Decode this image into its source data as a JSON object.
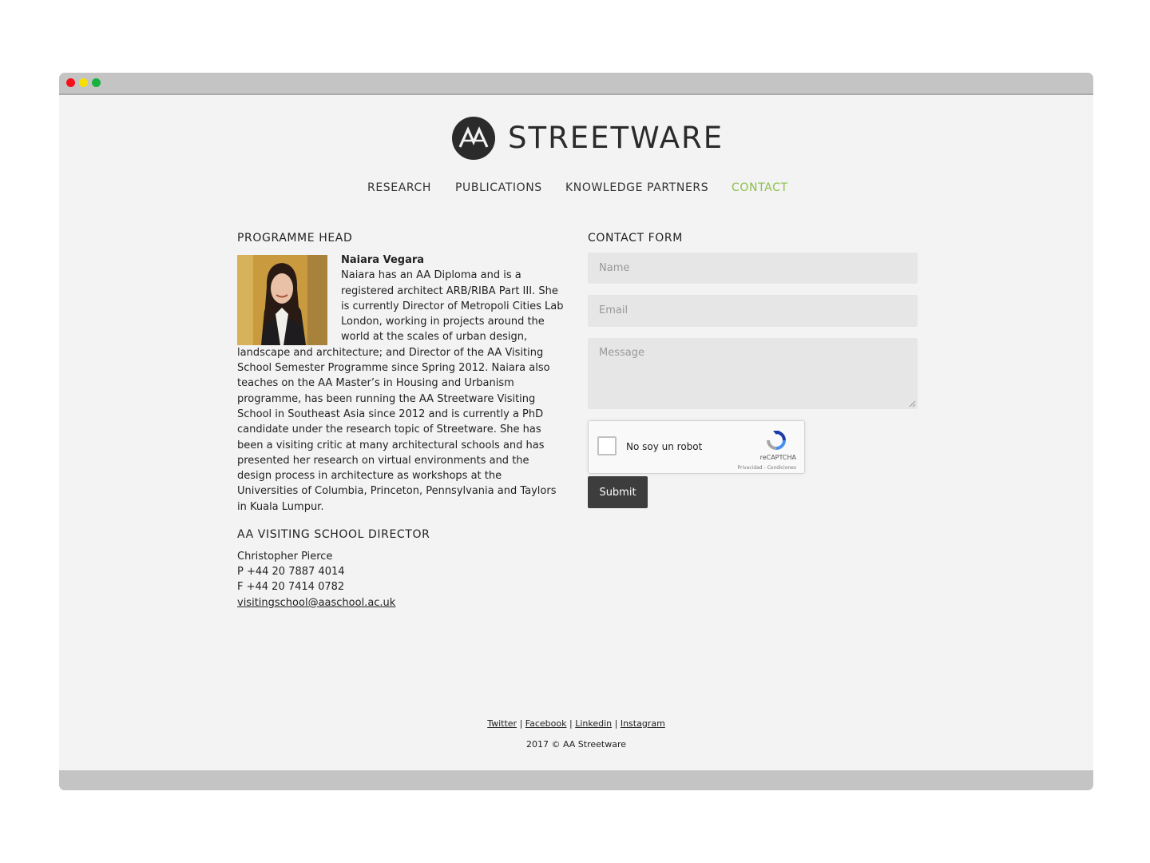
{
  "window": {
    "controls": [
      "close",
      "minimize",
      "zoom"
    ]
  },
  "brand": {
    "name": "STREETWARE",
    "logo_icon": "aa-logo-icon"
  },
  "nav": {
    "items": [
      {
        "label": "RESEARCH",
        "active": false
      },
      {
        "label": "PUBLICATIONS",
        "active": false
      },
      {
        "label": "KNOWLEDGE PARTNERS",
        "active": false
      },
      {
        "label": "CONTACT",
        "active": true
      }
    ],
    "active_color": "#8cc04a"
  },
  "programme_head": {
    "heading": "PROGRAMME HEAD",
    "name": "Naiara Vegara",
    "bio": "Naiara has an AA Diploma and is a registered architect ARB/RIBA Part III. She is currently Director of Metropoli Cities Lab London, working in projects around the world at the scales of urban design, landscape and architecture; and Director of the AA Visiting School Semester Programme since Spring 2012. Naiara also teaches on the AA Master’s in Housing and Urbanism programme, has been running the AA Streetware Visiting School in Southeast Asia since 2012 and is currently a PhD candidate under the research topic of Streetware. She has been a visiting critic at many architectural schools and has presented her research on virtual environments and the design process in architecture as workshops at the Universities of Columbia, Princeton, Pennsylvania and Taylors in Kuala Lumpur."
  },
  "director": {
    "heading": "AA VISITING SCHOOL DIRECTOR",
    "name": "Christopher Pierce",
    "phone": "P +44 20 7887 4014",
    "fax": "F +44 20 7414 0782",
    "email": "visitingschool@aaschool.ac.uk"
  },
  "contact_form": {
    "heading": "CONTACT FORM",
    "name_placeholder": "Name",
    "email_placeholder": "Email",
    "message_placeholder": "Message",
    "recaptcha_label": "No soy un robot",
    "recaptcha_brand": "reCAPTCHA",
    "recaptcha_terms": "Privacidad - Condiciones",
    "submit_label": "Submit"
  },
  "footer": {
    "links": [
      "Twitter",
      "Facebook",
      "Linkedin",
      "Instagram"
    ],
    "separator": "|",
    "copyright": "2017 © AA Streetware"
  }
}
